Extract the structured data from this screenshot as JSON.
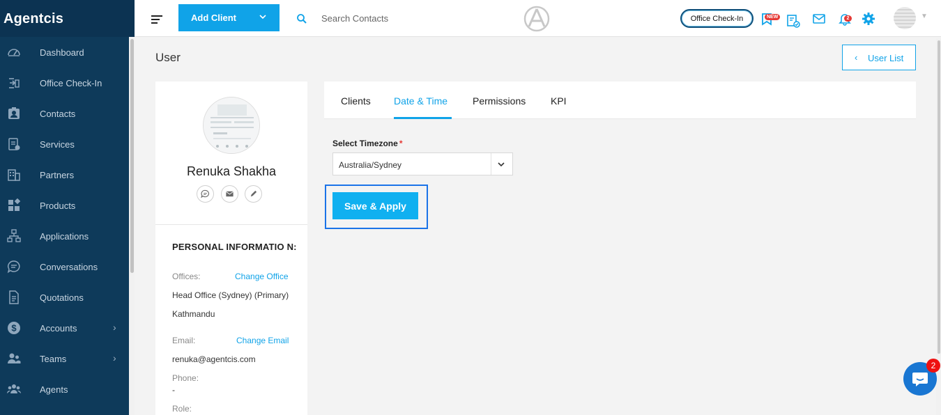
{
  "brand": "Agentcis",
  "sidebar": {
    "items": [
      {
        "label": "Dashboard",
        "icon": "dashboard-icon",
        "has_chevron": false
      },
      {
        "label": "Office Check-In",
        "icon": "office-checkin-icon",
        "has_chevron": false
      },
      {
        "label": "Contacts",
        "icon": "contacts-icon",
        "has_chevron": false
      },
      {
        "label": "Services",
        "icon": "services-icon",
        "has_chevron": false
      },
      {
        "label": "Partners",
        "icon": "partners-icon",
        "has_chevron": false
      },
      {
        "label": "Products",
        "icon": "products-icon",
        "has_chevron": false
      },
      {
        "label": "Applications",
        "icon": "applications-icon",
        "has_chevron": false
      },
      {
        "label": "Conversations",
        "icon": "conversations-icon",
        "has_chevron": false
      },
      {
        "label": "Quotations",
        "icon": "quotations-icon",
        "has_chevron": false
      },
      {
        "label": "Accounts",
        "icon": "accounts-icon",
        "has_chevron": true
      },
      {
        "label": "Teams",
        "icon": "teams-icon",
        "has_chevron": true
      },
      {
        "label": "Agents",
        "icon": "agents-icon",
        "has_chevron": false
      }
    ]
  },
  "topbar": {
    "add_client_label": "Add Client",
    "search_placeholder": "Search Contacts",
    "office_checkin_label": "Office Check-In",
    "new_badge": "NEW",
    "notification_count": "2"
  },
  "page": {
    "title": "User",
    "user_list_label": "User List"
  },
  "profile": {
    "name": "Renuka Shakha",
    "section_title": "PERSONAL INFORMATIO N:",
    "offices_label": "Offices:",
    "change_office_label": "Change Office",
    "offices_value_1": "Head Office (Sydney) (Primary)",
    "offices_value_2": "Kathmandu",
    "email_label": "Email:",
    "change_email_label": "Change Email",
    "email_value": "renuka@agentcis.com",
    "phone_label": "Phone:",
    "phone_value": "-",
    "role_label": "Role:"
  },
  "tabs": [
    {
      "label": "Clients",
      "active": false
    },
    {
      "label": "Date & Time",
      "active": true
    },
    {
      "label": "Permissions",
      "active": false
    },
    {
      "label": "KPI",
      "active": false
    }
  ],
  "timezone": {
    "label": "Select Timezone",
    "required_mark": "*",
    "value": "Australia/Sydney"
  },
  "save_apply_label": "Save & Apply",
  "chat": {
    "badge": "2"
  },
  "colors": {
    "sidebar_bg": "#0e3a5a",
    "accent": "#10a3e8",
    "focus_outline": "#1a73e8",
    "badge_red": "#e53935"
  }
}
